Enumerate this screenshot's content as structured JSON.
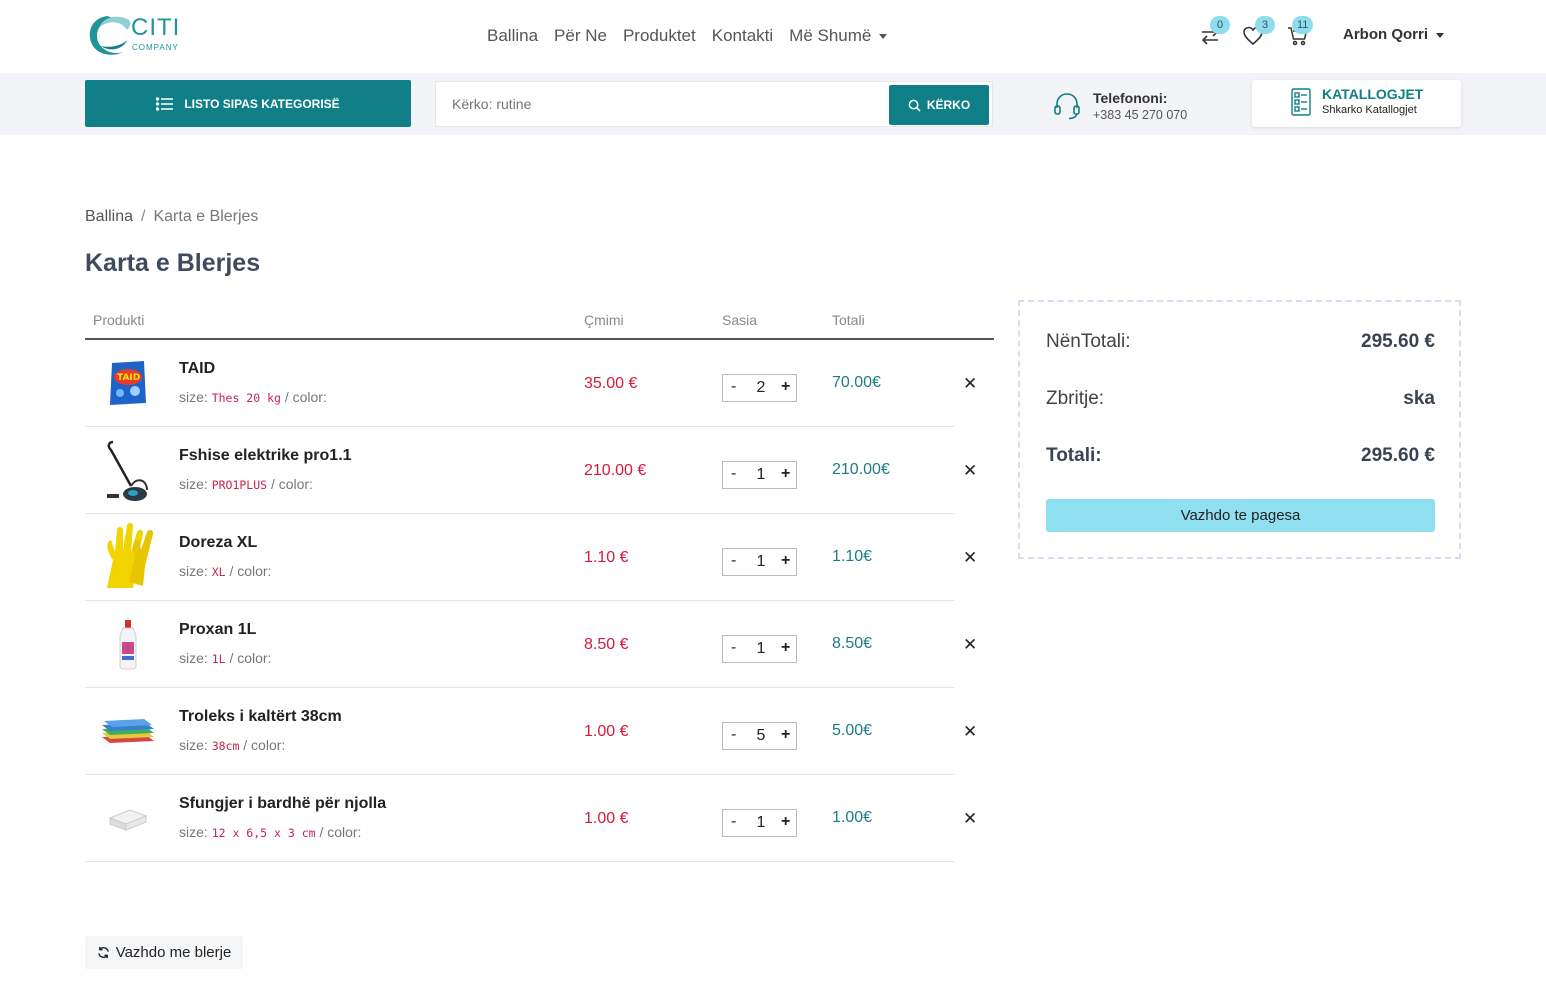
{
  "brand": {
    "name": "CITI",
    "tagline": "COMPANY",
    "accent": "#117f87",
    "logo_color": "#21939b"
  },
  "nav": {
    "items": [
      "Ballina",
      "Për Ne",
      "Produktet",
      "Kontakti",
      "Më Shumë"
    ],
    "compare_count": "0",
    "wishlist_count": "3",
    "cart_count": "11",
    "user": "Arbon Qorri"
  },
  "toolbar": {
    "category_button": "LISTO SIPAS KATEGORISË",
    "search_placeholder": "Kërko: rutine",
    "search_button": "KËRKO",
    "phone_label": "Telefononi:",
    "phone_number": "+383 45 270 070",
    "catalog_title": "KATALLOGJET",
    "catalog_sub": "Shkarko Katallogjet"
  },
  "breadcrumb": {
    "home": "Ballina",
    "separator": "/",
    "current": "Karta e Blerjes"
  },
  "page_title": "Karta e Blerjes",
  "table": {
    "headers": {
      "product": "Produkti",
      "price": "Çmimi",
      "qty": "Sasia",
      "total": "Totali"
    },
    "size_label": "size:",
    "color_label": "/ color:",
    "rows": [
      {
        "name": "TAID",
        "size": "Thes 20 kg",
        "price": "35.00 €",
        "qty": "2",
        "total": "70.00€"
      },
      {
        "name": "Fshise elektrike pro1.1",
        "size": "PRO1PLUS",
        "price": "210.00 €",
        "qty": "1",
        "total": "210.00€"
      },
      {
        "name": "Doreza XL",
        "size": "XL",
        "price": "1.10 €",
        "qty": "1",
        "total": "1.10€"
      },
      {
        "name": "Proxan 1L",
        "size": "1L",
        "price": "8.50 €",
        "qty": "1",
        "total": "8.50€"
      },
      {
        "name": "Troleks i kaltërt 38cm",
        "size": "38cm",
        "price": "1.00 €",
        "qty": "5",
        "total": "5.00€"
      },
      {
        "name": "Sfungjer i bardhë për njolla",
        "size": "12 x 6,5 x 3 cm",
        "price": "1.00 €",
        "qty": "1",
        "total": "1.00€"
      }
    ]
  },
  "summary": {
    "subtotal_label": "NënTotali:",
    "subtotal": "295.60 €",
    "discount_label": "Zbritje:",
    "discount": "ska",
    "total_label": "Totali:",
    "total": "295.60 €",
    "checkout_button": "Vazhdo te pagesa"
  },
  "continue_button": "Vazhdo me blerje",
  "icons": {
    "compare": "compare-arrows-icon",
    "wishlist": "heart-icon",
    "cart": "cart-icon",
    "category": "list-icon",
    "search": "search-icon",
    "phone": "headset-icon",
    "catalog": "catalog-icon",
    "remove": "close-icon",
    "continue": "refresh-icon"
  }
}
